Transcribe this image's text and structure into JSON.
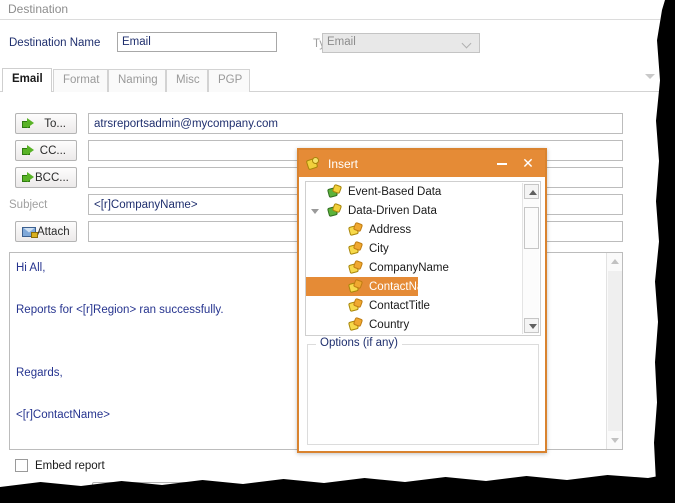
{
  "section": {
    "title": "Destination"
  },
  "destination": {
    "name_label": "Destination Name",
    "name_value": "Email",
    "type_label": "Type",
    "type_value": "Email",
    "type_options": [
      "Email"
    ]
  },
  "tabs": [
    {
      "label": "Email",
      "active": true
    },
    {
      "label": "Format",
      "active": false
    },
    {
      "label": "Naming",
      "active": false
    },
    {
      "label": "Misc",
      "active": false
    },
    {
      "label": "PGP",
      "active": false
    }
  ],
  "email_form": {
    "to_button": "To...",
    "to_value": "atrsreportsadmin@mycompany.com",
    "cc_button": "CC...",
    "cc_value": "",
    "bcc_button": "BCC...",
    "bcc_value": "",
    "subject_label": "Subject",
    "subject_value": "<[r]CompanyName>",
    "attach_button": "Attach",
    "attach_value": "",
    "body_value": "Hi All,\n\nReports for <[r]Region> ran successfully.\n\n\nRegards,\n\n<[r]ContactName>"
  },
  "footer": {
    "embed_report_label": "Embed report",
    "embed_report_checked": false
  },
  "insert_dialog": {
    "title": "Insert",
    "minimize_label": "─",
    "close_label": "✕",
    "tree": [
      {
        "label": "Event-Based Data",
        "level": 0,
        "type": "group",
        "expander": "",
        "selected": false
      },
      {
        "label": "Data-Driven Data",
        "level": 0,
        "type": "group",
        "expander": "open",
        "selected": false
      },
      {
        "label": "Address",
        "level": 1,
        "type": "leaf",
        "expander": "",
        "selected": false
      },
      {
        "label": "City",
        "level": 1,
        "type": "leaf",
        "expander": "",
        "selected": false
      },
      {
        "label": "CompanyName",
        "level": 1,
        "type": "leaf",
        "expander": "",
        "selected": false
      },
      {
        "label": "ContactName",
        "level": 1,
        "type": "leaf",
        "expander": "",
        "selected": true
      },
      {
        "label": "ContactTitle",
        "level": 1,
        "type": "leaf",
        "expander": "",
        "selected": false
      },
      {
        "label": "Country",
        "level": 1,
        "type": "leaf",
        "expander": "",
        "selected": false
      }
    ],
    "options_legend": "Options (if any)"
  },
  "colors": {
    "accent_orange": "#e58b36",
    "dialog_border": "#d9832f",
    "label_navy": "#1f2f6e",
    "text_navy": "#26348f",
    "disabled_grey": "#a0a0a0"
  }
}
